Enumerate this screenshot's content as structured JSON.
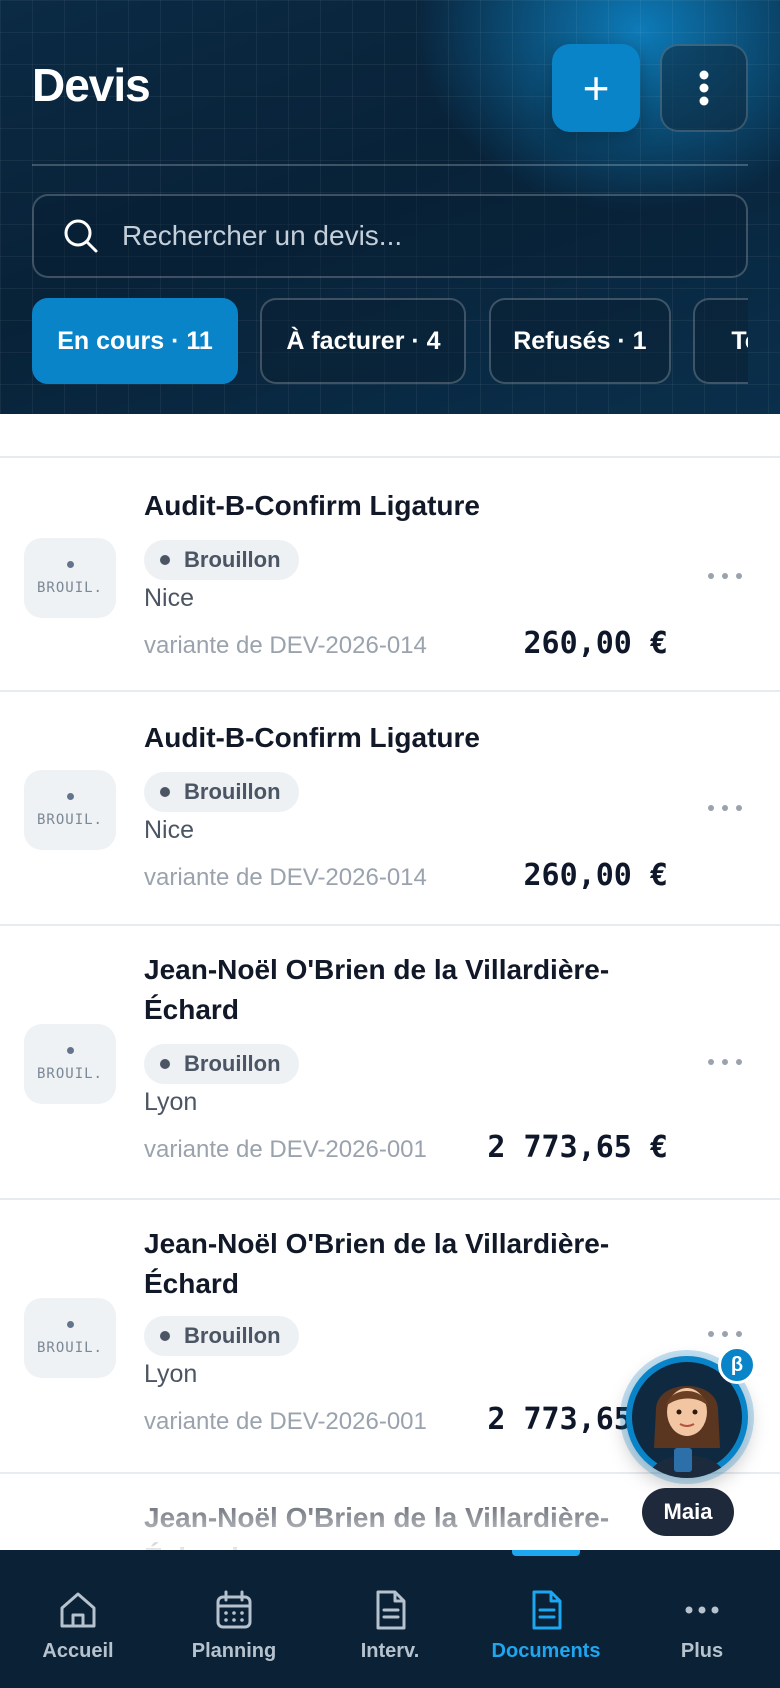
{
  "header": {
    "title": "Devis",
    "add_label": "+",
    "search_placeholder": "Rechercher un devis..."
  },
  "filters": [
    {
      "label": "En cours · 11",
      "active": true
    },
    {
      "label": "À facturer · 4",
      "active": false
    },
    {
      "label": "Refusés · 1",
      "active": false
    },
    {
      "label": "To",
      "active": false
    }
  ],
  "rows": [
    {
      "title": "Audit-B-Confirm Ligature",
      "badge": "Brouillon",
      "city": "Nice",
      "variant": "variante de DEV-2026-014",
      "amount": "260,00 €",
      "thumb": "BROUIL."
    },
    {
      "title": "Audit-B-Confirm Ligature",
      "badge": "Brouillon",
      "city": "Nice",
      "variant": "variante de DEV-2026-014",
      "amount": "260,00 €",
      "thumb": "BROUIL."
    },
    {
      "title": "Jean-Noël O'Brien de la Villardière-Échard",
      "badge": "Brouillon",
      "city": "Lyon",
      "variant": "variante de DEV-2026-001",
      "amount": "2 773,65 €",
      "thumb": "BROUIL."
    },
    {
      "title": "Jean-Noël O'Brien de la Villardière-Échard",
      "badge": "Brouillon",
      "city": "Lyon",
      "variant": "variante de DEV-2026-001",
      "amount": "2 773,65 €",
      "thumb": "BROUIL."
    },
    {
      "title": "Jean-Noël O'Brien de la Villardière-Échard"
    }
  ],
  "assistant": {
    "name": "Maia",
    "badge": "β"
  },
  "nav": [
    {
      "label": "Accueil",
      "icon": "home-icon",
      "active": false
    },
    {
      "label": "Planning",
      "icon": "calendar-icon",
      "active": false
    },
    {
      "label": "Interv.",
      "icon": "file-icon",
      "active": false
    },
    {
      "label": "Documents",
      "icon": "document-icon",
      "active": true
    },
    {
      "label": "Plus",
      "icon": "more-icon",
      "active": false
    }
  ],
  "colors": {
    "accent": "#0a84c8",
    "nav_active": "#1ea7f0",
    "header_bg": "#082238"
  }
}
